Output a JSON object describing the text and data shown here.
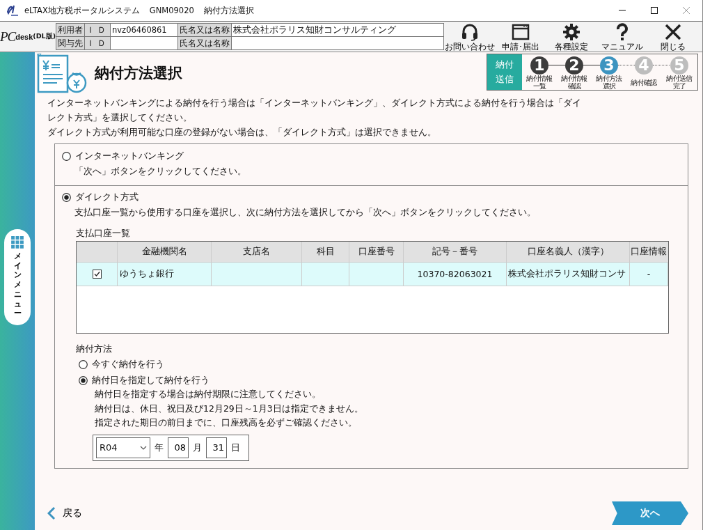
{
  "window": {
    "app_name": "eLTAX地方税ポータルシステム",
    "screen_id": "GNM09020",
    "screen_name": "納付方法選択"
  },
  "logo": {
    "pc": "PC",
    "desk": "desk",
    "edition": "(DL版)"
  },
  "user_info": [
    {
      "label": "利用者",
      "id_label": "ＩＤ",
      "id": "nvz06460861",
      "name_label": "氏名又は名称",
      "name": "株式会社ポラリス知財コンサルティング"
    },
    {
      "label": "関与先",
      "id_label": "ＩＤ",
      "name_label": "氏名又は名称"
    }
  ],
  "toolbar": [
    {
      "kind": "headset",
      "label": "お問い合わせ"
    },
    {
      "kind": "window",
      "label": "申請･届出"
    },
    {
      "kind": "gear",
      "label": "各種設定"
    },
    {
      "kind": "question",
      "label": "マニュアル"
    },
    {
      "kind": "close",
      "label": "閉じる"
    }
  ],
  "side_menu": {
    "label": "メインメニュー"
  },
  "page": {
    "title": "納付方法選択",
    "intro": [
      "インターネットバンキングによる納付を行う場合は「インターネットバンキング」、ダイレクト方式による納付を行う場合は「ダイレクト方式」を選択してください。",
      "ダイレクト方式が利用可能な口座の登録がない場合は、「ダイレクト方式」は選択できません。"
    ]
  },
  "steps": {
    "group_label": [
      "納付",
      "送信"
    ],
    "items": [
      {
        "number": "1",
        "lines": [
          "納付情報",
          "一覧"
        ],
        "completed": true,
        "selected": false
      },
      {
        "number": "2",
        "lines": [
          "納付情報",
          "確認"
        ],
        "completed": true,
        "selected": false
      },
      {
        "number": "3",
        "lines": [
          "納付方法",
          "選択"
        ],
        "completed": false,
        "selected": true
      },
      {
        "number": "4",
        "lines": [
          "納付確認"
        ],
        "completed": false,
        "selected": false
      },
      {
        "number": "5",
        "lines": [
          "納付送信",
          "完了"
        ],
        "completed": false,
        "selected": false
      }
    ]
  },
  "options": [
    {
      "label": "インターネットバンキング",
      "selected": false,
      "note": "「次へ」ボタンをクリックしてください。"
    },
    {
      "label": "ダイレクト方式",
      "selected": true,
      "note": "支払口座一覧から使用する口座を選択し、次に納付方法を選択してから「次へ」ボタンをクリックしてください。",
      "accounts": {
        "title": "支払口座一覧",
        "columns": [
          "金融機関名",
          "支店名",
          "科目",
          "口座番号",
          "記号－番号",
          "口座名義人（漢字）",
          "口座情報"
        ],
        "rows": [
          {
            "checked": true,
            "selected": true,
            "cells": [
              "ゆうちょ銀行",
              null,
              null,
              null,
              "10370-82063021",
              "株式会社ポラリス知財コンサ",
              "-"
            ]
          }
        ]
      },
      "payment_method": {
        "title": "納付方法",
        "choices": [
          {
            "label": "今すぐ納付を行う",
            "selected": false
          },
          {
            "label": "納付日を指定して納付を行う",
            "selected": true,
            "notes": [
              "納付日を指定する場合は納付期限に注意してください。",
              "納付日は、休日、祝日及び12月29日～1月3日は指定できません。",
              "指定された期日の前日までに、口座残高を必ずご確認ください。"
            ],
            "date": {
              "era": "R04",
              "year_unit": "年",
              "month": "08",
              "month_unit": "月",
              "day": "31",
              "day_unit": "日"
            }
          }
        ]
      }
    }
  ],
  "footer": {
    "back": "戻る",
    "next": "次へ"
  }
}
